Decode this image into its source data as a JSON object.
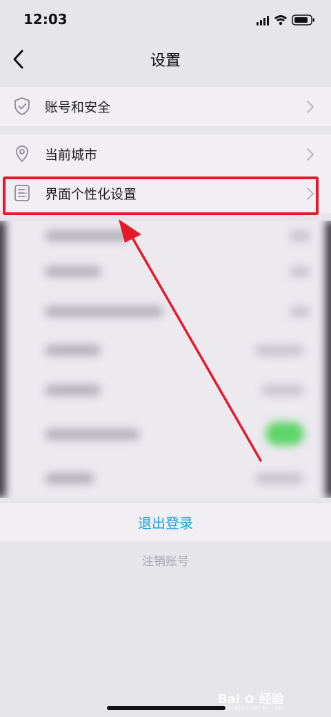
{
  "status_bar": {
    "time": "12:03"
  },
  "nav": {
    "title": "设置"
  },
  "settings": {
    "group1": [
      {
        "label": "账号和安全",
        "icon": "shield-icon"
      }
    ],
    "group2": [
      {
        "label": "当前城市",
        "icon": "location-pin-icon"
      },
      {
        "label": "界面个性化设置",
        "icon": "list-document-icon"
      }
    ]
  },
  "logout": {
    "label": "退出登录"
  },
  "cancel_account": {
    "label": "注销账号"
  },
  "watermark": {
    "brand": "Bai",
    "brand_cn": "经验",
    "url": "jingyan.baidu.com"
  },
  "colors": {
    "accent_blue": "#1ea0e0",
    "highlight_red": "#e8182b",
    "background": "#e6e5ea",
    "row_background": "#f1eff4"
  }
}
